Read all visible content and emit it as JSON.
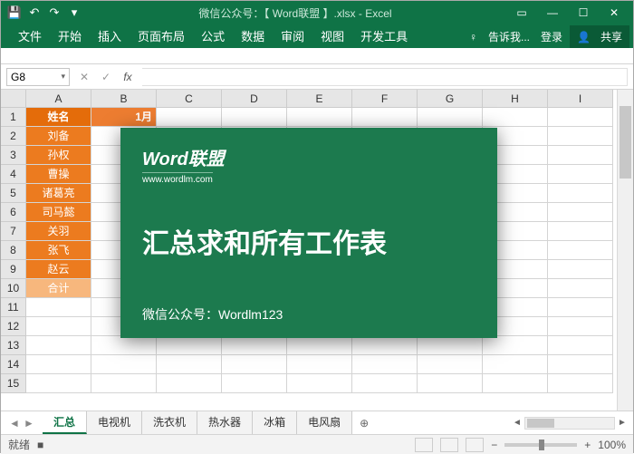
{
  "titlebar": {
    "title": "微信公众号：【 Word联盟 】.xlsx - Excel"
  },
  "qat": {
    "save": "💾",
    "undo": "↶",
    "redo": "↷"
  },
  "wincontrols": {
    "help": "?",
    "full": "▭",
    "min": "—",
    "max": "☐",
    "close": "✕"
  },
  "ribbon": {
    "tabs": [
      "文件",
      "开始",
      "插入",
      "页面布局",
      "公式",
      "数据",
      "审阅",
      "视图",
      "开发工具"
    ],
    "tell_me": "告诉我...",
    "login": "登录",
    "share": "共享"
  },
  "namebox": "G8",
  "fx": {
    "cancel": "✕",
    "confirm": "✓",
    "fx": "fx"
  },
  "columns": [
    "A",
    "B",
    "C",
    "D",
    "E",
    "F",
    "G",
    "H",
    "I"
  ],
  "rows": [
    "1",
    "2",
    "3",
    "4",
    "5",
    "6",
    "7",
    "8",
    "9",
    "10",
    "11",
    "12",
    "13",
    "14",
    "15"
  ],
  "data_col_a": [
    "姓名",
    "刘备",
    "孙权",
    "曹操",
    "诸葛亮",
    "司马懿",
    "关羽",
    "张飞",
    "赵云",
    "合计"
  ],
  "data_b1": "1月",
  "overlay": {
    "logo": "Word联盟",
    "logo_sub": "www.wordlm.com",
    "headline": "汇总求和所有工作表",
    "footer": "微信公众号：Wordlm123"
  },
  "sheets": {
    "active": "汇总",
    "tabs": [
      "汇总",
      "电视机",
      "洗衣机",
      "热水器",
      "冰箱",
      "电风扇"
    ],
    "add": "⊕"
  },
  "status": {
    "ready": "就绪",
    "rec": "■",
    "zoom": "100%",
    "minus": "−",
    "plus": "+"
  }
}
